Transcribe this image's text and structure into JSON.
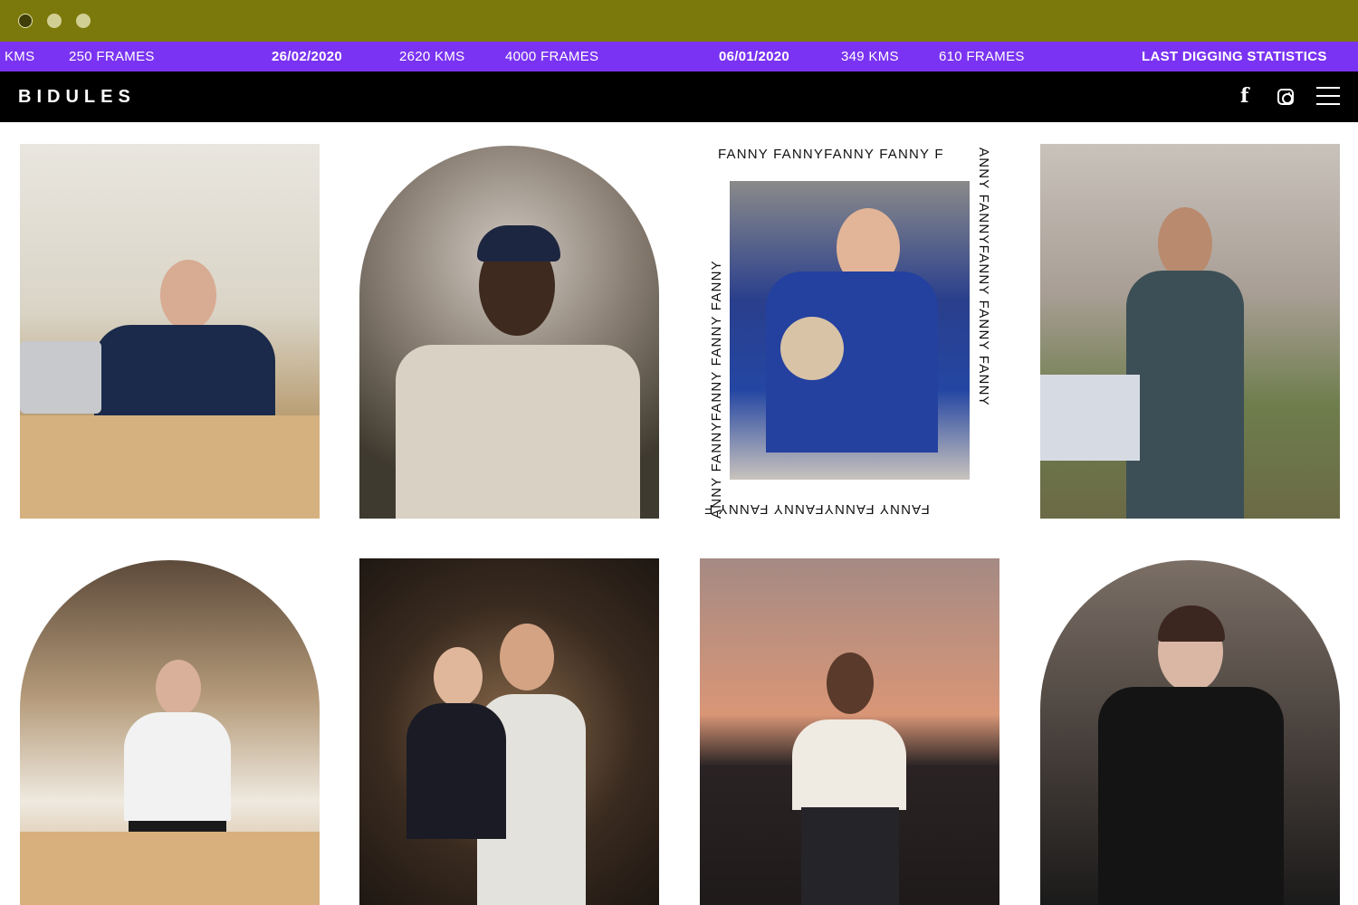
{
  "window": {
    "controls": [
      "close-dot",
      "minimize-dot",
      "maximize-dot"
    ]
  },
  "ticker": {
    "items": [
      "KMS",
      "250 FRAMES",
      "26/02/2020",
      "2620 KMS",
      "4000 FRAMES",
      "06/01/2020",
      "349 KMS",
      "610 FRAMES",
      "LAST DIGGING STATISTICS"
    ]
  },
  "nav": {
    "logo": "BIDULES",
    "icons": [
      "facebook-icon",
      "instagram-icon",
      "menu-icon"
    ]
  },
  "gallery": {
    "fanny_border_top": "FANNY FANNYFANNY FANNY F",
    "fanny_border_right": "ANNY FANNYFANNY FANNY FANNY",
    "fanny_border_bottom": "FANNY FANNYFANNY FANNY F",
    "fanny_border_left": "ANNY FANNYFANNY FANNY FANNY"
  },
  "colors": {
    "chrome": "#7b790b",
    "ticker": "#7a33f2",
    "nav": "#000000"
  }
}
